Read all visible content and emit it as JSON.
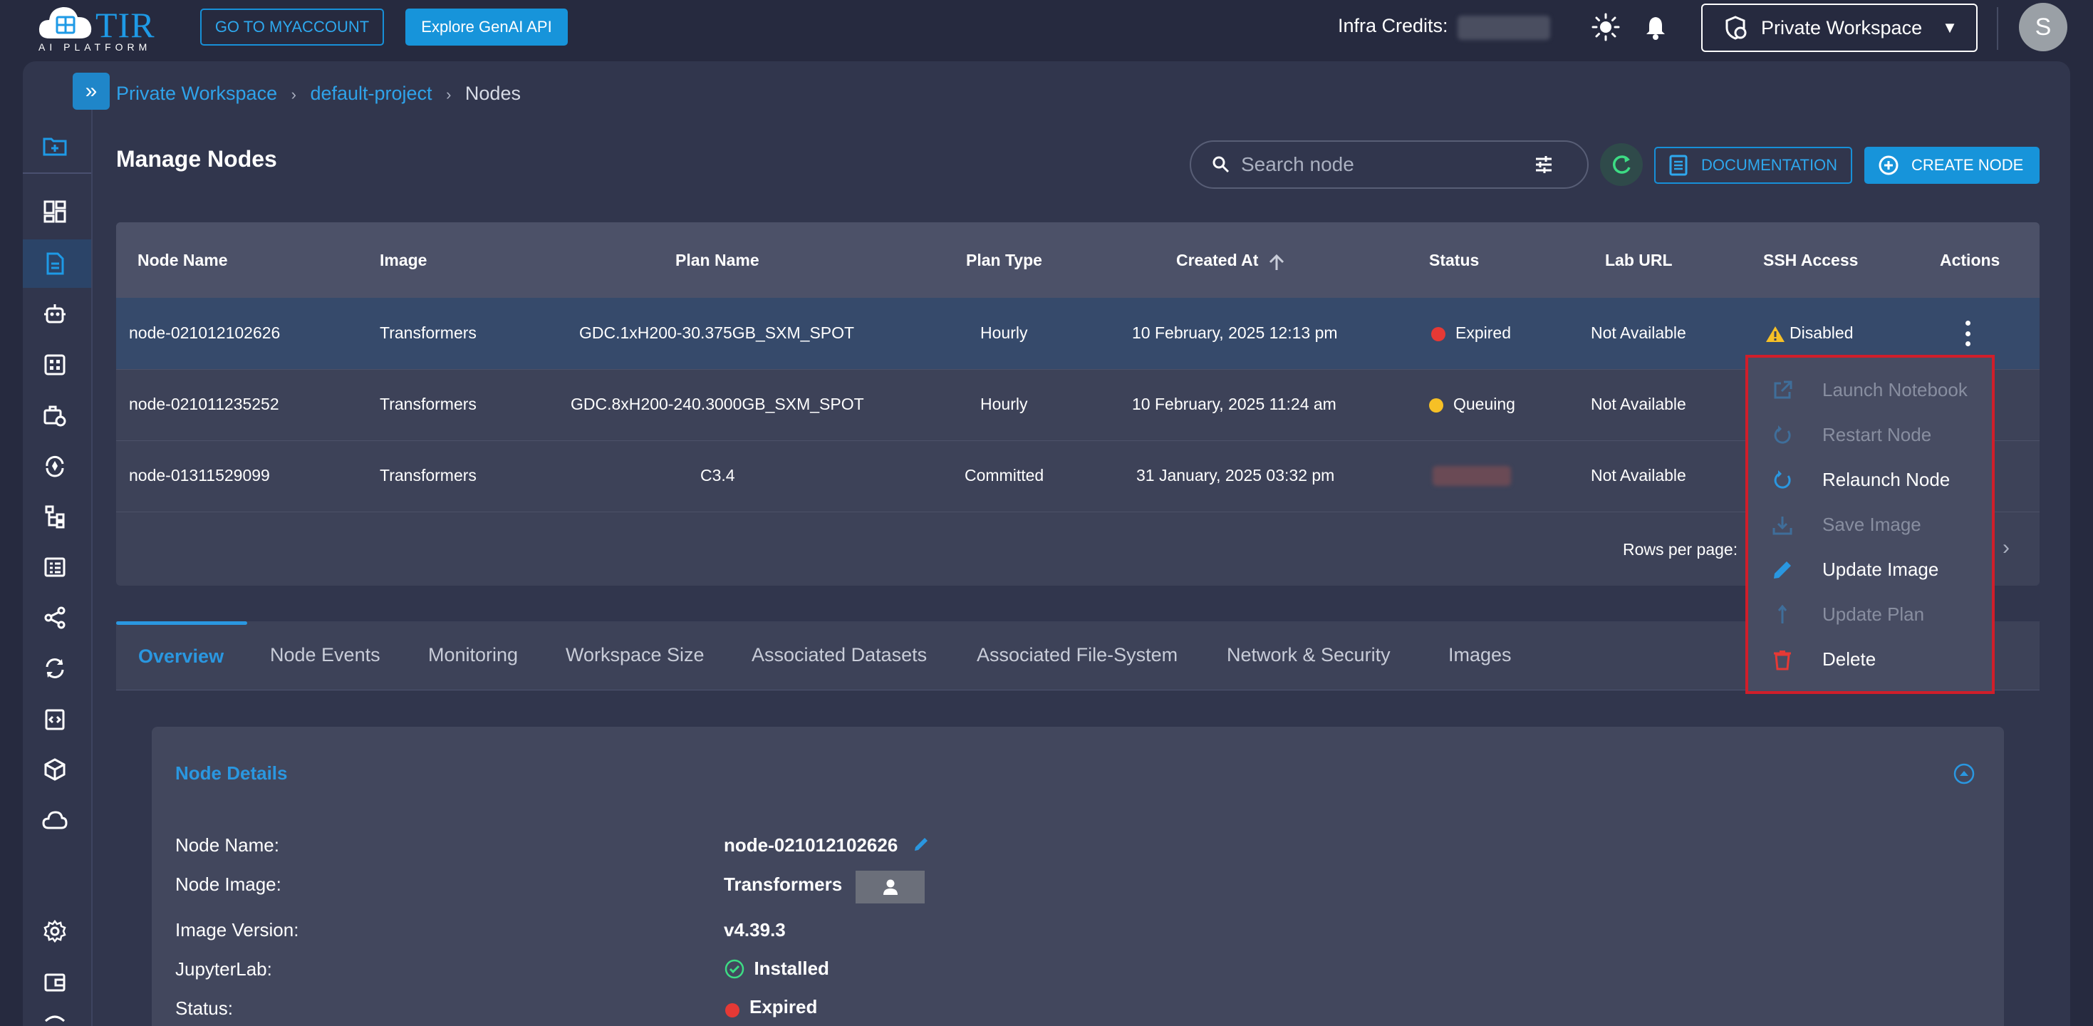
{
  "logo": {
    "name": "TIR",
    "subtitle": "AI PLATFORM"
  },
  "header": {
    "myaccount_label": "GO TO MYACCOUNT",
    "genai_label": "Explore GenAI API",
    "credits_label": "Infra Credits:",
    "workspace_label": "Private Workspace",
    "avatar_letter": "S"
  },
  "breadcrumb": {
    "workspace": "Private Workspace",
    "project": "default-project",
    "current": "Nodes",
    "sep": "›"
  },
  "page": {
    "title": "Manage Nodes",
    "search_placeholder": "Search node",
    "documentation_label": "DOCUMENTATION",
    "create_label": "CREATE NODE"
  },
  "table": {
    "columns": [
      "Node Name",
      "Image",
      "Plan Name",
      "Plan Type",
      "Created At",
      "Status",
      "Lab URL",
      "SSH Access",
      "Actions"
    ],
    "rows": [
      {
        "name": "node-021012102626",
        "image": "Transformers",
        "plan": "GDC.1xH200-30.375GB_SXM_SPOT",
        "plan_type": "Hourly",
        "created": "10 February, 2025 12:13 pm",
        "status": "Expired",
        "lab": "Not Available",
        "ssh": "Disabled"
      },
      {
        "name": "node-021011235252",
        "image": "Transformers",
        "plan": "GDC.8xH200-240.3000GB_SXM_SPOT",
        "plan_type": "Hourly",
        "created": "10 February, 2025 11:24 am",
        "status": "Queuing",
        "lab": "Not Available",
        "ssh": ""
      },
      {
        "name": "node-01311529099",
        "image": "Transformers",
        "plan": "C3.4",
        "plan_type": "Committed",
        "created": "31 January, 2025 03:32 pm",
        "status": "",
        "lab": "Not Available",
        "ssh": ""
      }
    ],
    "rows_per_page_label": "Rows per page:"
  },
  "menu": {
    "items": [
      {
        "label": "Launch Notebook",
        "icon": "external-link-icon",
        "enabled": false
      },
      {
        "label": "Restart Node",
        "icon": "restart-icon",
        "enabled": false
      },
      {
        "label": "Relaunch Node",
        "icon": "relaunch-icon",
        "enabled": true
      },
      {
        "label": "Save Image",
        "icon": "download-icon",
        "enabled": false
      },
      {
        "label": "Update Image",
        "icon": "pencil-icon",
        "enabled": true
      },
      {
        "label": "Update Plan",
        "icon": "arrow-up-icon",
        "enabled": false
      },
      {
        "label": "Delete",
        "icon": "trash-icon",
        "enabled": true
      }
    ]
  },
  "tabs": [
    "Overview",
    "Node Events",
    "Monitoring",
    "Workspace Size",
    "Associated Datasets",
    "Associated File-System",
    "Network & Security",
    "Images"
  ],
  "details": {
    "title": "Node Details",
    "fields": [
      {
        "label": "Node Name:",
        "value": "node-021012102626"
      },
      {
        "label": "Node Image:",
        "value": "Transformers"
      },
      {
        "label": "Image Version:",
        "value": "v4.39.3"
      },
      {
        "label": "JupyterLab:",
        "value": "Installed"
      },
      {
        "label": "Status:",
        "value": "Expired"
      }
    ]
  },
  "colors": {
    "accent": "#1794da",
    "expired": "#e53935",
    "queuing": "#f6c026",
    "menu_border": "#d01e2a",
    "warning": "#f6c026"
  }
}
